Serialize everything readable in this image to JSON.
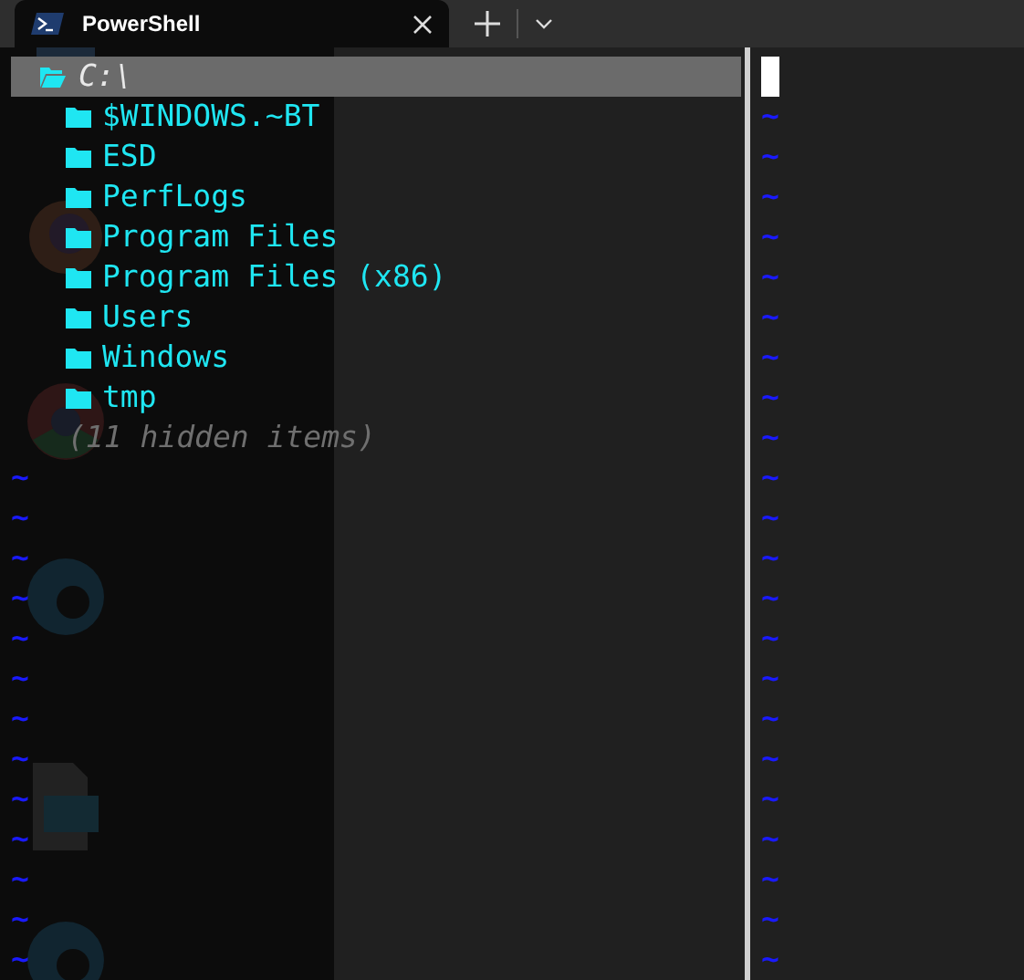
{
  "tab": {
    "title": "PowerShell"
  },
  "tree": {
    "root": {
      "label": "C:\\",
      "selected": true
    },
    "children": [
      {
        "label": "$WINDOWS.~BT",
        "selected": false
      },
      {
        "label": "ESD",
        "selected": false
      },
      {
        "label": "PerfLogs",
        "selected": false
      },
      {
        "label": "Program Files",
        "selected": false
      },
      {
        "label": "Program Files (x86)",
        "selected": false
      },
      {
        "label": "Users",
        "selected": false
      },
      {
        "label": "Windows",
        "selected": false
      },
      {
        "label": "tmp",
        "selected": false
      }
    ],
    "hidden_note": "(11 hidden items)"
  },
  "left_pane": {
    "empty_lines": [
      "~",
      "~",
      "~",
      "~",
      "~",
      "~",
      "~",
      "~",
      "~",
      "~",
      "~",
      "~",
      "~"
    ]
  },
  "right_pane": {
    "empty_lines": [
      "~",
      "~",
      "~",
      "~",
      "~",
      "~",
      "~",
      "~",
      "~",
      "~",
      "~",
      "~",
      "~",
      "~",
      "~",
      "~",
      "~",
      "~",
      "~",
      "~",
      "~",
      "~"
    ]
  }
}
